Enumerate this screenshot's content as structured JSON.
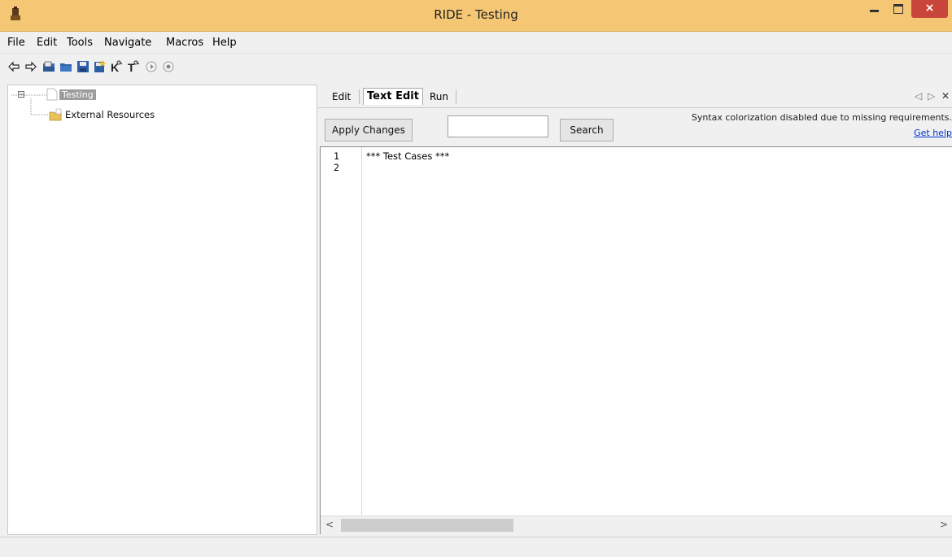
{
  "window": {
    "title": "RIDE - Testing",
    "close_glyph": "×"
  },
  "menu": {
    "items": [
      "File",
      "Edit",
      "Tools",
      "Navigate",
      "Macros",
      "Help"
    ]
  },
  "toolbar": {
    "icons": [
      "back-arrow-icon",
      "forward-arrow-icon",
      "open-suite-icon",
      "open-directory-icon",
      "save-icon",
      "save-all-icon",
      "search-keywords-icon",
      "search-tests-icon",
      "run-icon",
      "stop-icon"
    ]
  },
  "tree": {
    "root_label": "Testing",
    "child_label": "External Resources",
    "expand_glyph": "⊟"
  },
  "tabs": {
    "items": [
      "Edit",
      "Text Edit",
      "Run"
    ],
    "active": "Text Edit",
    "nav_left": "◁",
    "nav_right": "▷",
    "close": "✕"
  },
  "editor_toolbar": {
    "apply_label": "Apply Changes",
    "search_value": "",
    "search_label": "Search",
    "syntax_message": "Syntax colorization disabled due to missing requirements.",
    "help_link": "Get help"
  },
  "editor": {
    "line_numbers": [
      "1",
      "2"
    ],
    "lines": [
      "*** Test Cases ***",
      ""
    ]
  },
  "scrollbar": {
    "left_arrow": "<",
    "right_arrow": ">"
  },
  "colors": {
    "titlebar": "#f5c774",
    "close_button": "#c9463d",
    "link": "#0033cc"
  }
}
